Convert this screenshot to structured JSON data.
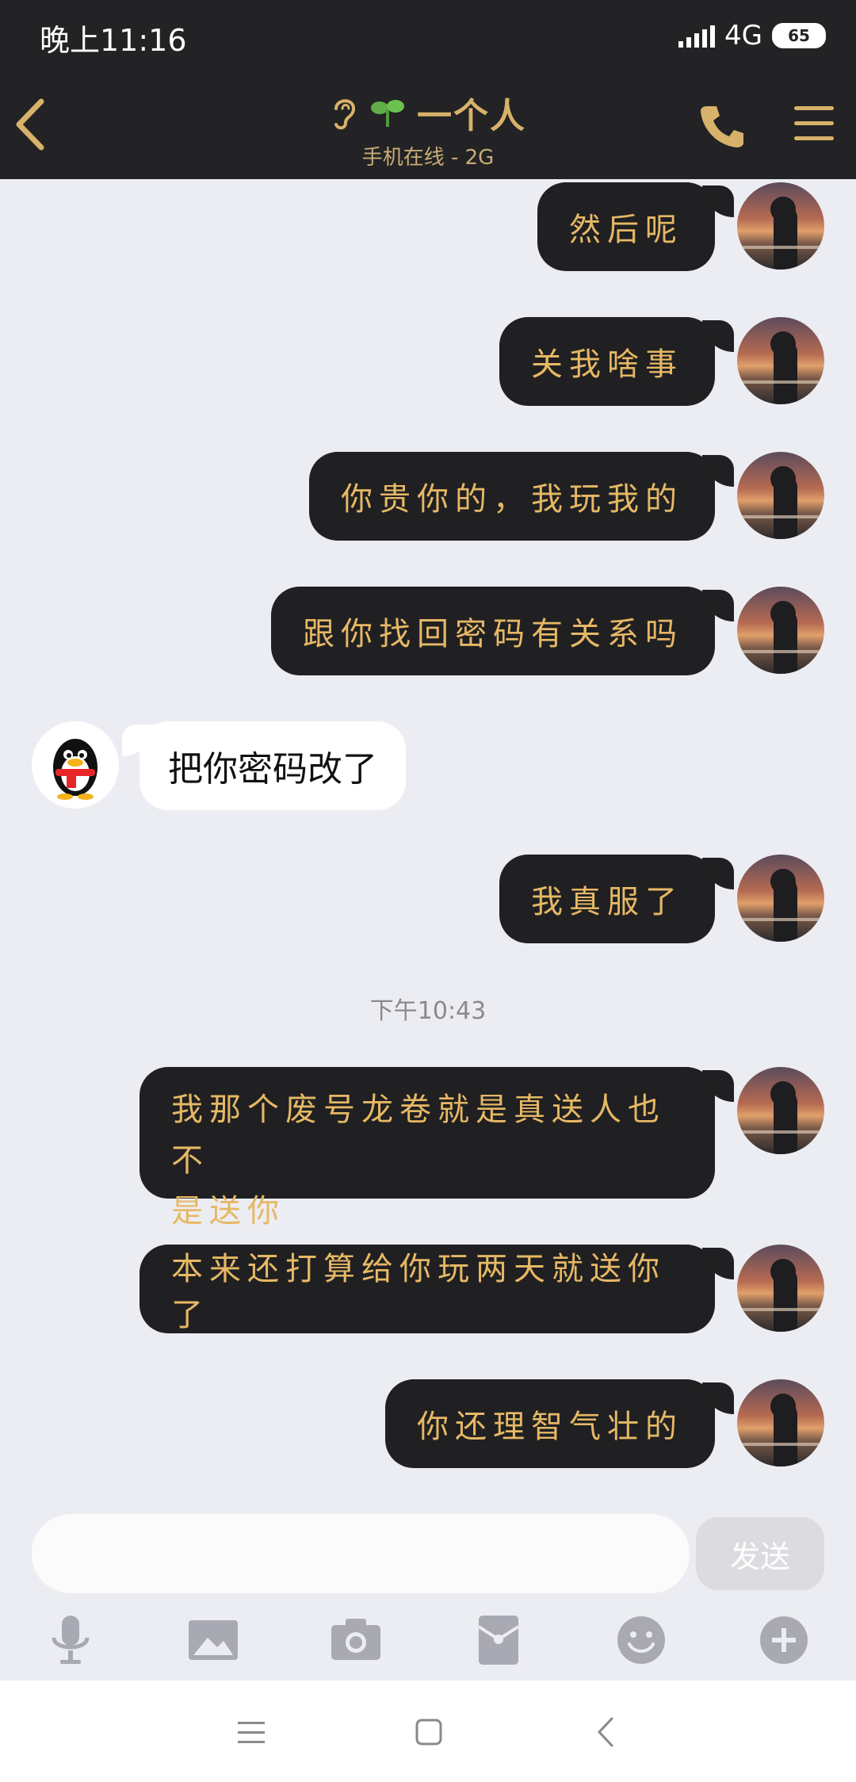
{
  "status": {
    "time": "晚上11:16",
    "network": "4G",
    "battery": "65"
  },
  "header": {
    "title": "一个人",
    "subtitle": "手机在线 - 2G"
  },
  "messages": [
    {
      "side": "me",
      "text": "然后呢"
    },
    {
      "side": "me",
      "text": "关我啥事"
    },
    {
      "side": "me",
      "text": "你贵你的，我玩我的"
    },
    {
      "side": "me",
      "text": "跟你找回密码有关系吗"
    },
    {
      "side": "other",
      "text": "把你密码改了"
    },
    {
      "side": "me",
      "text": "我真服了"
    },
    {
      "side": "time",
      "text": "下午10:43"
    },
    {
      "side": "me",
      "lines": [
        "我那个废号龙卷就是真送人也不",
        "是送你"
      ]
    },
    {
      "side": "me",
      "text": "本来还打算给你玩两天就送你了"
    },
    {
      "side": "me",
      "text": "你还理智气壮的"
    }
  ],
  "input": {
    "placeholder": "",
    "send_label": "发送"
  },
  "toolbar": [
    "microphone-icon",
    "image-icon",
    "camera-icon",
    "red-packet-icon",
    "emoji-icon",
    "plus-icon"
  ],
  "colors": {
    "header_bg": "#232325",
    "accent": "#d8b26a",
    "bubble_me": "#202022",
    "bubble_text": "#e6b865",
    "chat_bg": "#ecedf2"
  }
}
